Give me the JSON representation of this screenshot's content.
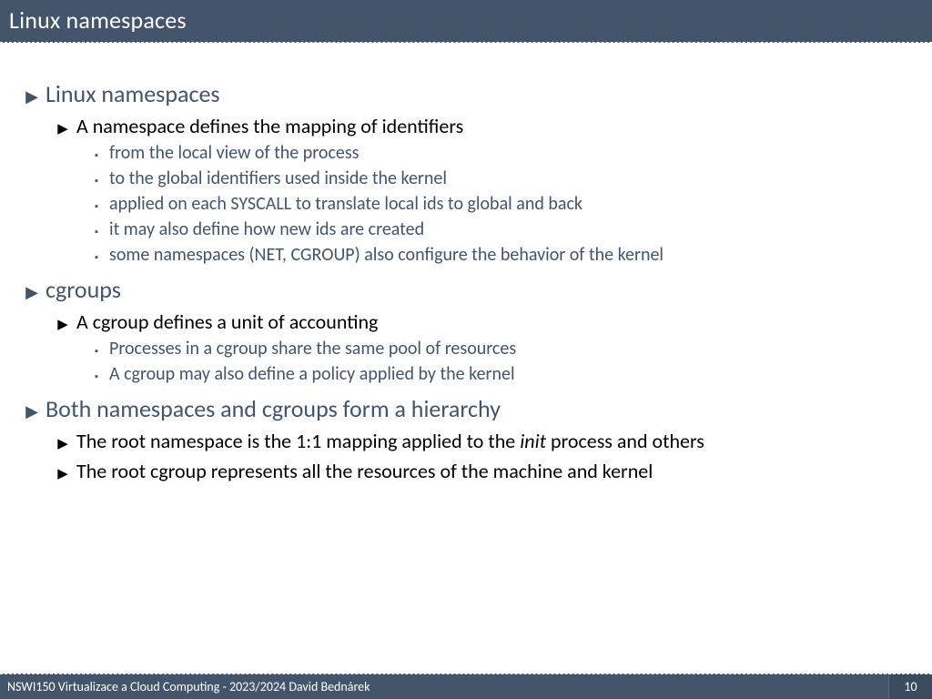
{
  "title": "Linux namespaces",
  "sections": [
    {
      "heading": "Linux namespaces",
      "subs": [
        {
          "text": "A namespace defines the mapping of identifiers",
          "items": [
            "from the local view of the process",
            "to the global identifiers used inside the kernel",
            "applied on each SYSCALL to translate local ids to global and back",
            "it may also define how new ids are created",
            "some namespaces (NET, CGROUP) also configure the behavior of the kernel"
          ]
        }
      ]
    },
    {
      "heading": "cgroups",
      "subs": [
        {
          "text": "A cgroup defines a unit of accounting",
          "items": [
            "Processes in a cgroup share the same pool of resources",
            "A cgroup may also define a policy applied by the kernel"
          ]
        }
      ]
    },
    {
      "heading": "Both namespaces and cgroups form a hierarchy",
      "subs": [
        {
          "text_html": "The root namespace is the 1:1 mapping applied to the <em class=\"init\">init</em> process and others",
          "items": []
        },
        {
          "text": "The root cgroup represents all the resources of the machine and kernel",
          "items": []
        }
      ]
    }
  ],
  "footer": {
    "left": "NSWI150 Virtualizace a Cloud Computing - 2023/2024 David Bednárek",
    "page": "10"
  }
}
